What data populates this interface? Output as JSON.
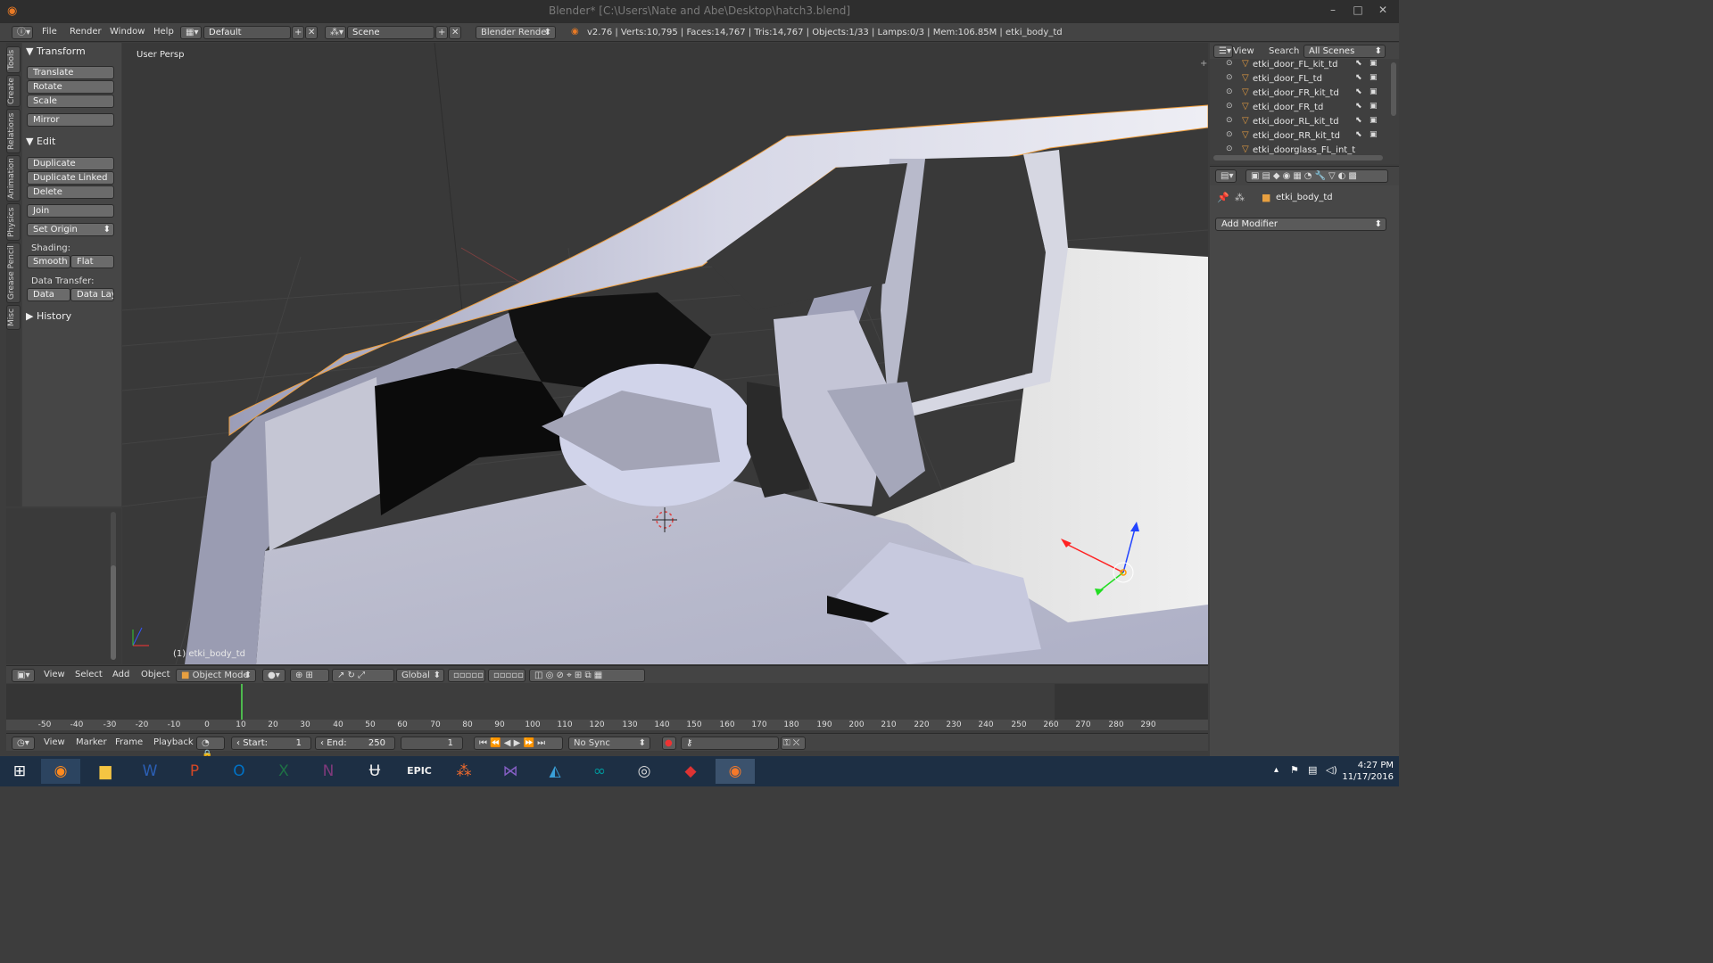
{
  "window": {
    "title": "Blender* [C:\\Users\\Nate and Abe\\Desktop\\hatch3.blend]",
    "minimize": "–",
    "maximize": "□",
    "close": "✕"
  },
  "info_header": {
    "menus": [
      "File",
      "Render",
      "Window",
      "Help"
    ],
    "layout": "Default",
    "scene": "Scene",
    "engine": "Blender Render",
    "stats": "v2.76 | Verts:10,795 | Faces:14,767 | Tris:14,767 | Objects:1/33 | Lamps:0/3 | Mem:106.85M | etki_body_td"
  },
  "tool_tabs": [
    "Tools",
    "Create",
    "Relations",
    "Animation",
    "Physics",
    "Grease Pencil",
    "Misc"
  ],
  "tool_shelf": {
    "transform": {
      "title": "Transform",
      "buttons": [
        "Translate",
        "Rotate",
        "Scale",
        "Mirror"
      ]
    },
    "edit": {
      "title": "Edit",
      "buttons": [
        "Duplicate",
        "Duplicate Linked",
        "Delete",
        "Join"
      ],
      "set_origin": "Set Origin",
      "shading_label": "Shading:",
      "smooth": "Smooth",
      "flat": "Flat",
      "data_transfer_label": "Data Transfer:",
      "data": "Data",
      "data_layout": "Data Layo"
    },
    "history": {
      "title": "History"
    }
  },
  "viewport": {
    "view_name": "User Persp",
    "object_label": "(1) etki_body_td"
  },
  "viewport_header": {
    "menus": [
      "View",
      "Select",
      "Add",
      "Object"
    ],
    "mode": "Object Mode",
    "orientation": "Global"
  },
  "timeline": {
    "ticks": [
      "-50",
      "-40",
      "-30",
      "-20",
      "-10",
      "0",
      "10",
      "20",
      "30",
      "40",
      "50",
      "60",
      "70",
      "80",
      "90",
      "100",
      "110",
      "120",
      "130",
      "140",
      "150",
      "160",
      "170",
      "180",
      "190",
      "200",
      "210",
      "220",
      "230",
      "240",
      "250",
      "260",
      "270",
      "280",
      "290"
    ],
    "menus": [
      "View",
      "Marker",
      "Frame",
      "Playback"
    ],
    "start_label": "Start:",
    "start_value": "1",
    "end_label": "End:",
    "end_value": "250",
    "current_frame": "1",
    "sync": "No Sync"
  },
  "outliner": {
    "menus": [
      "View",
      "Search"
    ],
    "filter": "All Scenes",
    "items": [
      "etki_door_FL_kit_td",
      "etki_door_FL_td",
      "etki_door_FR_kit_td",
      "etki_door_FR_td",
      "etki_door_RL_kit_td",
      "etki_door_RR_kit_td",
      "etki_doorglass_FL_int_t"
    ]
  },
  "properties": {
    "object_name": "etki_body_td",
    "add_modifier": "Add Modifier"
  },
  "taskbar": {
    "apps": [
      "windows-start",
      "firefox",
      "file-explorer",
      "word",
      "powerpoint",
      "outlook",
      "excel",
      "onenote",
      "unreal-engine",
      "epic-games",
      "origin",
      "visual-studio",
      "unity",
      "arduino",
      "steam",
      "vivaldi",
      "blender"
    ],
    "epic_label": "EPIC",
    "time": "4:27 PM",
    "date": "11/17/2016"
  }
}
